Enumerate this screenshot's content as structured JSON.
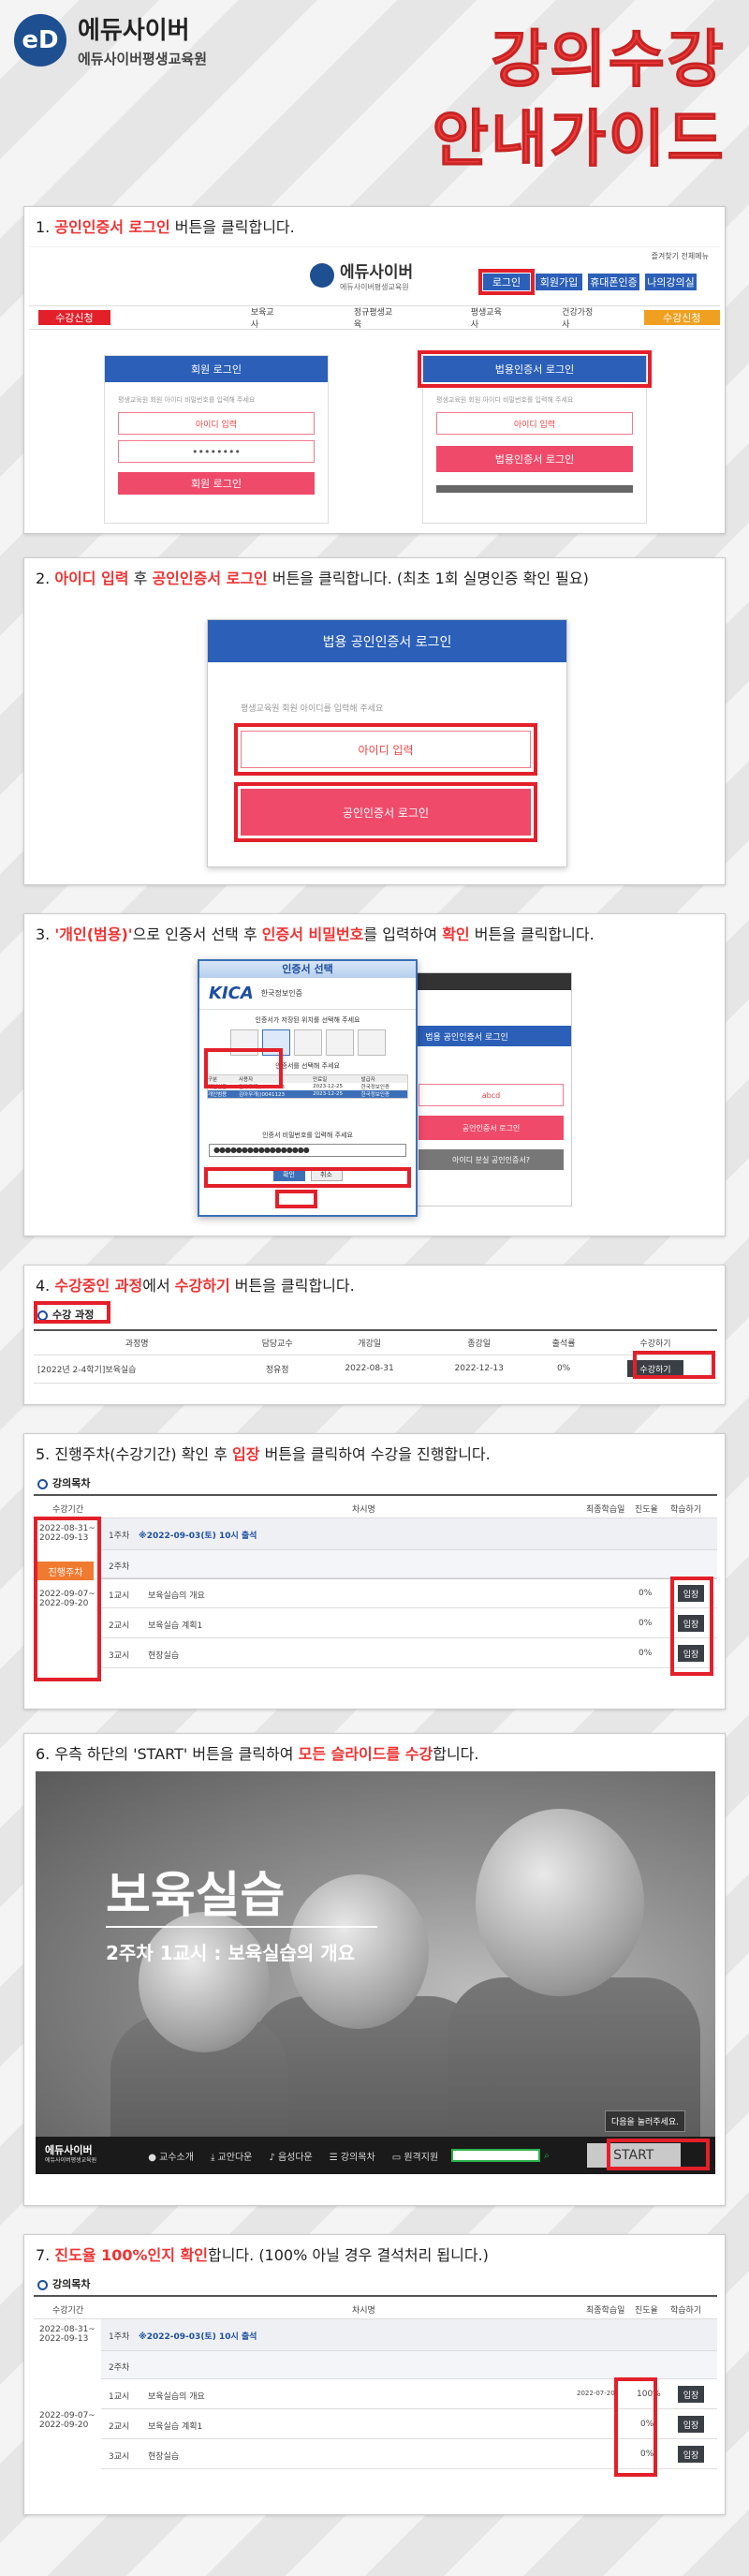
{
  "header": {
    "logo_mark": "eD",
    "logo_title": "에듀사이버",
    "logo_sub": "에듀사이버평생교육원",
    "big_title_1": "강의수강",
    "big_title_2": "안내가이드"
  },
  "step1": {
    "num": "1.",
    "hl": "공인인증서 로그인",
    "rest": " 버튼을 클릭합니다.",
    "site_logo": "에듀사이버",
    "site_sub": "에듀사이버평생교육원",
    "top_links": "즐겨찾기 전체메뉴",
    "nav_btns": [
      "로그인",
      "회원가입",
      "휴대폰인증",
      "나의강의실"
    ],
    "menu": [
      "보육교사",
      "정규평생교육",
      "평생교육사",
      "건강가정사"
    ],
    "left_tag": "수강신청",
    "right_tag": "수강신청",
    "member_login": "회원 로그인",
    "corp_login": "법용인증서 로그인",
    "hint": "평생교육원 회원 아이디 비밀번호를 입력해 주세요",
    "id_ph": "아이디 입력",
    "pw_ph": "••••••••",
    "login_btn": "회원 로그인",
    "cert_btn": "법용인증서 로그인"
  },
  "step2": {
    "num": "2.",
    "hl1": "아이디 입력",
    "mid": " 후 ",
    "hl2": "공인인증서 로그인",
    "rest": " 버튼을 클릭합니다. (최초 1회 실명인증 확인 필요)",
    "panel_title": "법용 공인인증서 로그인",
    "hint": "평생교육원 회원 아이디를 입력해 주세요",
    "id_ph": "아이디 입력",
    "cert_btn": "공인인증서 로그인"
  },
  "step3": {
    "num": "3.",
    "hl1": "'개인(범용)'",
    "mid1": "으로 인증서 선택 후 ",
    "hl2": "인증서 비밀번호",
    "mid2": "를 입력하여 ",
    "hl3": "확인",
    "rest": " 버튼을 클릭합니다.",
    "dlg_title": "인증서 선택",
    "kica": "KICA",
    "kica_sub": "한국정보인증",
    "media": "인증서가 저장된 위치를 선택해 주세요",
    "list_head": "인증서를 선택해 주세요",
    "cols": [
      "구분",
      "사용자",
      "만료일",
      "발급자"
    ],
    "rows": [
      [
        "개인범용",
        "김아무개()0041123",
        "2023-12-25",
        "한국정보인증"
      ],
      [
        "개인범용",
        "김아무개()0041123",
        "2023-12-25",
        "한국정보인증"
      ]
    ],
    "pw_label": "인증서 비밀번호를 입력해 주세요",
    "pw_val": "●●●●●●●●●●●●●●●●●",
    "ok": "확인",
    "cancel": "취소",
    "bg_title": "법용 공인인증서 로그인",
    "bg_btn": "공인인증서 로그인",
    "bg_footer": "아이디 분실 공인인증서?"
  },
  "step4": {
    "num": "4.",
    "hl1": "수강중인 과정",
    "mid": "에서 ",
    "hl2": "수강하기",
    "rest": " 버튼을 클릭합니다.",
    "sec": "수강 과정",
    "cols": [
      "과정명",
      "담당교수",
      "개강일",
      "종강일",
      "출석률",
      "수강하기"
    ],
    "row": [
      "[2022년 2-4학기]보육실습",
      "정유정",
      "2022-08-31",
      "2022-12-13",
      "0%",
      "수강하기"
    ]
  },
  "step5": {
    "num": "5.",
    "pre": "진행주차(수강기간) 확인 후 ",
    "hl": "입장",
    "rest": " 버튼을 클릭하여 수강을 진행합니다.",
    "sec": "강의목차",
    "cols": [
      "수강기간",
      "차시명",
      "최종학습일",
      "진도율",
      "학습하기"
    ],
    "w1_period": "2022-08-31~ 2022-09-13",
    "w1_label": "1주차",
    "w1_note": "※2022-09-03(토) 10시 출석",
    "tag": "진행주차",
    "w2_period": "2022-09-07~ 2022-09-20",
    "w2_label": "2주차",
    "lessons": [
      [
        "1교시",
        "보육실습의 개요",
        "0%",
        "입장"
      ],
      [
        "2교시",
        "보육실습 계획1",
        "0%",
        "입장"
      ],
      [
        "3교시",
        "현장실습",
        "0%",
        "입장"
      ]
    ]
  },
  "step6": {
    "num": "6.",
    "pre": "우측 하단의 'START' 버튼을 클릭하여 ",
    "hl": "모든 슬라이드를 수강",
    "rest": "합니다.",
    "title": "보육실습",
    "sub": "2주차 1교시 : 보육실습의 개요",
    "tip": "다음을 눌러주세요.",
    "start": "START",
    "bar_logo": "에듀사이버",
    "bar_logo_sub": "에듀사이버평생교육원",
    "bar_items": [
      "교수소개",
      "교안다운",
      "음성다운",
      "강의목차",
      "원격지원"
    ]
  },
  "step7": {
    "num": "7.",
    "hl": "진도율 100%인지 확인",
    "rest": "합니다. (100% 아닐 경우 결석처리 됩니다.)",
    "sec": "강의목차",
    "cols": [
      "수강기간",
      "차시명",
      "최종학습일",
      "진도율",
      "학습하기"
    ],
    "w1_period": "2022-08-31~ 2022-09-13",
    "w1_label": "1주차",
    "w1_note": "※2022-09-03(토) 10시 출석",
    "w2_period": "2022-09-07~ 2022-09-20",
    "w2_label": "2주차",
    "lessons": [
      [
        "1교시",
        "보육실습의 개요",
        "2022-07-20",
        "100%",
        "입장"
      ],
      [
        "2교시",
        "보육실습 계획1",
        "",
        "0%",
        "입장"
      ],
      [
        "3교시",
        "현장실습",
        "",
        "0%",
        "입장"
      ]
    ]
  }
}
